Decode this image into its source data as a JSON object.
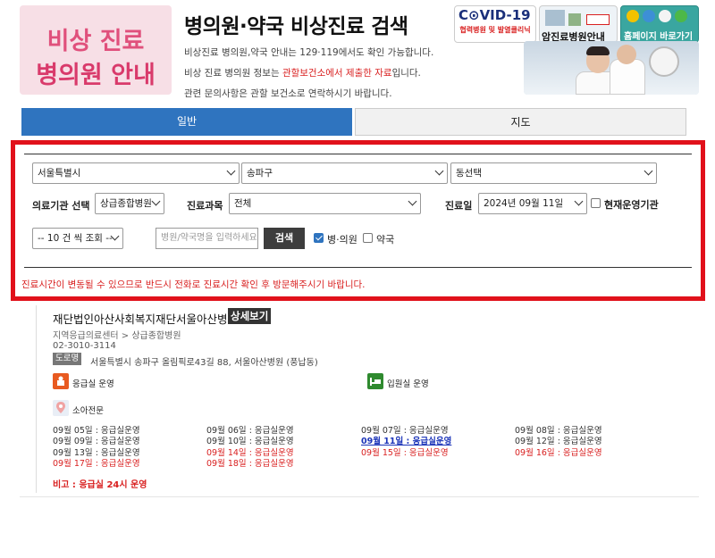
{
  "header": {
    "logo_line1": "비상 진료",
    "logo_line2": "병의원 안내",
    "title": "병의원·약국 비상진료 검색",
    "info1": "비상진료 병의원,약국 안내는 129·119에서도 확인 가능합니다.",
    "info2_pre": "비상 진료 병의원 정보는 ",
    "info2_hl": "관할보건소에서 제출한 자료",
    "info2_post": "입니다.",
    "info3": "관련 문의사항은 관할 보건소로 연락하시기 바랍니다."
  },
  "banners": {
    "covid_title": "C⊙VID-19",
    "covid_sub": "협력병원 및 발열클리닉",
    "cancer": "암진료병원안내",
    "homepage": "홈페이지 바로가기"
  },
  "tabs": {
    "general": "일반",
    "map": "지도"
  },
  "search": {
    "city": "서울특별시",
    "district": "송파구",
    "dong": "동선택",
    "institution_label": "의료기관 선택",
    "institution_value": "상급종합병원",
    "dept_label": "진료과목",
    "dept_value": "전체",
    "date_label": "진료일",
    "date_value": "2024년 09월 11일",
    "current_open_label": "현재운영기관",
    "current_open_checked": false,
    "page_size": "-- 10 건 씩 조회 --",
    "name_placeholder": "병원/약국명을 입력하세요",
    "search_button": "검색",
    "hospital_label": "병·의원",
    "hospital_checked": true,
    "pharmacy_label": "약국",
    "pharmacy_checked": false,
    "notice": "진료시간이 변동될 수 있으므로 반드시 전화로 진료시간 확인 후 방문해주시기 바랍니다."
  },
  "result": {
    "name": "재단법인아산사회복지재단서울아산병원",
    "detail_button": "상세보기",
    "type": "지역응급의료센터 > 상급종합병원",
    "phone": "02-3010-3114",
    "road_badge": "도로명",
    "address": "서울특별시 송파구 올림픽로43길 88, 서울아산병원 (풍납동)",
    "services": {
      "emergency": "응급실 운영",
      "inpatient": "입원실 운영",
      "pediatric": "소아전문"
    },
    "days": [
      {
        "text": "09월 05일 : 응급실운영",
        "style": "normal"
      },
      {
        "text": "09월 06일 : 응급실운영",
        "style": "normal"
      },
      {
        "text": "09월 07일 : 응급실운영",
        "style": "normal"
      },
      {
        "text": "09월 08일 : 응급실운영",
        "style": "normal"
      },
      {
        "text": "09월 09일 : 응급실운영",
        "style": "normal"
      },
      {
        "text": "09월 10일 : 응급실운영",
        "style": "normal"
      },
      {
        "text": "09월 11일 : 응급실운영",
        "style": "today"
      },
      {
        "text": "09월 12일 : 응급실운영",
        "style": "normal"
      },
      {
        "text": "09월 13일 : 응급실운영",
        "style": "normal"
      },
      {
        "text": "09월 14일 : 응급실운영",
        "style": "red"
      },
      {
        "text": "09월 15일 : 응급실운영",
        "style": "red"
      },
      {
        "text": "09월 16일 : 응급실운영",
        "style": "red"
      },
      {
        "text": "09월 17일 : 응급실운영",
        "style": "red"
      },
      {
        "text": "09월 18일 : 응급실운영",
        "style": "red"
      }
    ],
    "note": "비고 : 응급실 24시 운영"
  },
  "colors": {
    "primary": "#2f74bf",
    "alert": "#e1111b",
    "logo_pink": "#d93a6b"
  }
}
